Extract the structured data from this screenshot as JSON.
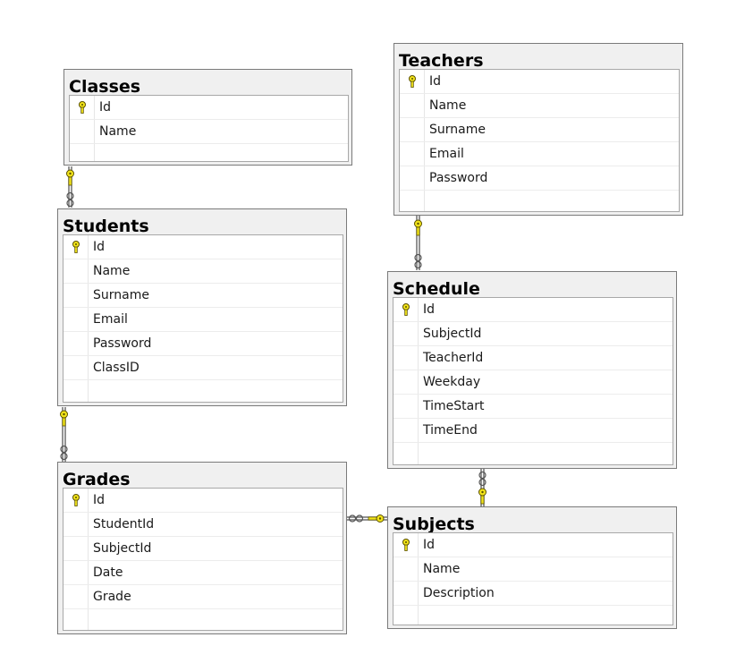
{
  "colors": {
    "connector_line": "#6f6f6f",
    "key_fill": "#f2e41a",
    "key_stroke": "#5a5000",
    "table_border": "#7a7a7a",
    "table_header_bg": "#f0f0f0"
  },
  "icons": {
    "primary_key": "key-icon",
    "relationship_one_end": "key-icon",
    "relationship_many_end": "infinity-icon"
  },
  "tables": {
    "classes": {
      "title": "Classes",
      "columns": [
        "Id",
        "Name"
      ],
      "primary_key": "Id"
    },
    "teachers": {
      "title": "Teachers",
      "columns": [
        "Id",
        "Name",
        "Surname",
        "Email",
        "Password"
      ],
      "primary_key": "Id"
    },
    "students": {
      "title": "Students",
      "columns": [
        "Id",
        "Name",
        "Surname",
        "Email",
        "Password",
        "ClassID"
      ],
      "primary_key": "Id"
    },
    "schedule": {
      "title": "Schedule",
      "columns": [
        "Id",
        "SubjectId",
        "TeacherId",
        "Weekday",
        "TimeStart",
        "TimeEnd"
      ],
      "primary_key": "Id"
    },
    "grades": {
      "title": "Grades",
      "columns": [
        "Id",
        "StudentId",
        "SubjectId",
        "Date",
        "Grade"
      ],
      "primary_key": "Id"
    },
    "subjects": {
      "title": "Subjects",
      "columns": [
        "Id",
        "Name",
        "Description"
      ],
      "primary_key": "Id"
    }
  },
  "relationships": [
    {
      "one": "classes",
      "many": "students"
    },
    {
      "one": "teachers",
      "many": "schedule"
    },
    {
      "one": "students",
      "many": "grades"
    },
    {
      "one": "subjects",
      "many": "schedule"
    },
    {
      "one": "subjects",
      "many": "grades"
    }
  ]
}
